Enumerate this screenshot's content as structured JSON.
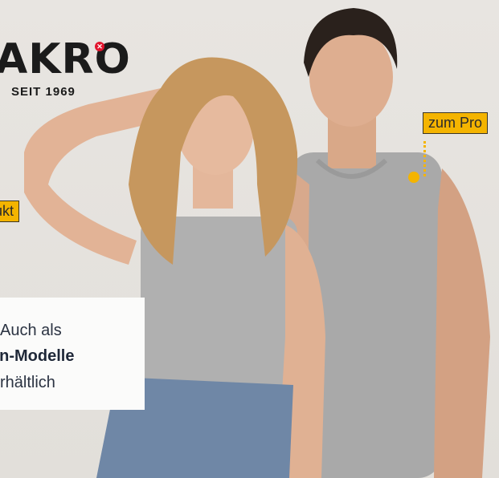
{
  "brand": {
    "name": "AKRO",
    "tagline": "SEIT 1969"
  },
  "hotspots": {
    "left_label": "ukt",
    "right_label": "zum Pro"
  },
  "info_card": {
    "line1": "Auch als",
    "line2": "en-Modelle",
    "line3": "rhältlich"
  },
  "colors": {
    "accent": "#f4b400",
    "brand_red": "#e2142d",
    "background": "#e4e1dc"
  }
}
